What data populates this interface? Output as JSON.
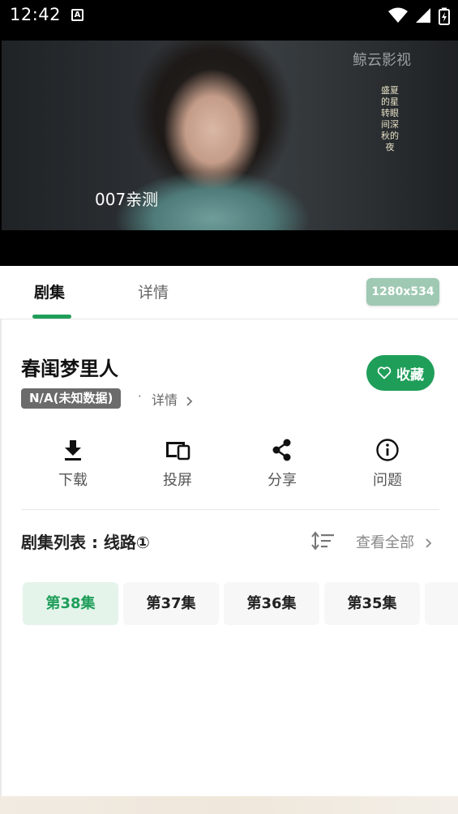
{
  "status_bar": {
    "time": "12:42",
    "notification_icon": "A"
  },
  "video": {
    "watermark": "鲸云影视",
    "vertical_caption": "盛夏的星转眼间深秋的夜",
    "overlay_text": "007亲测"
  },
  "tabs": {
    "episodes_label": "剧集",
    "details_label": "详情",
    "resolution": "1280x534"
  },
  "show": {
    "title": "春闺梦里人",
    "favorite_label": "收藏",
    "badge": "N/A(未知数据)",
    "separator": "·",
    "detail_link": "详情"
  },
  "actions": [
    {
      "label": "下载",
      "icon": "download-icon"
    },
    {
      "label": "投屏",
      "icon": "cast-icon"
    },
    {
      "label": "分享",
      "icon": "share-icon"
    },
    {
      "label": "问题",
      "icon": "info-icon"
    }
  ],
  "episode_list": {
    "title": "剧集列表 : 线路①",
    "view_all": "查看全部",
    "episodes": [
      "第38集",
      "第37集",
      "第36集",
      "第35集"
    ],
    "active_index": 0
  },
  "colors": {
    "accent": "#1f9e5a",
    "badge": "#9fc9b3"
  }
}
